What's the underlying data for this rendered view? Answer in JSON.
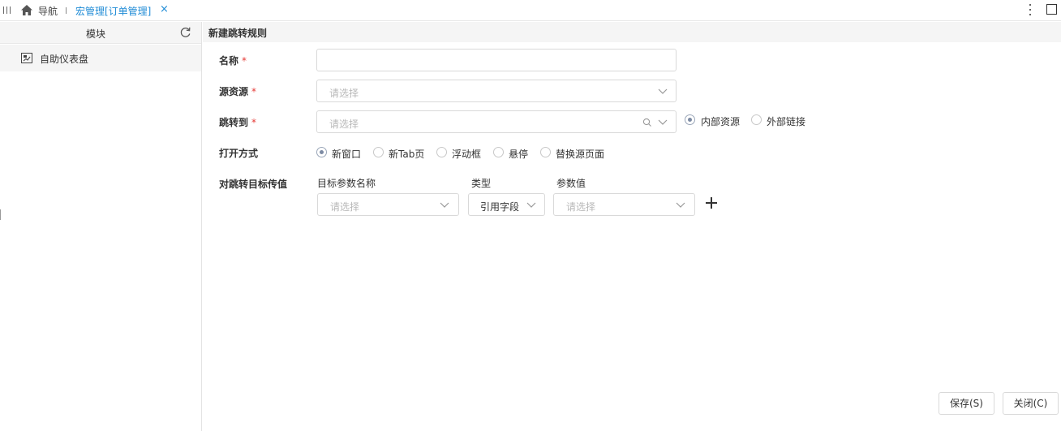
{
  "nav": {
    "label": "导航",
    "active_tab": "宏管理[订单管理]",
    "close_glyph": "×"
  },
  "sidebar": {
    "title": "模块",
    "items": [
      {
        "label": "自助仪表盘"
      }
    ]
  },
  "form": {
    "title": "新建跳转规则",
    "name": {
      "label": "名称",
      "required": "*",
      "value": ""
    },
    "source": {
      "label": "源资源",
      "required": "*",
      "placeholder": "请选择"
    },
    "target": {
      "label": "跳转到",
      "required": "*",
      "placeholder": "请选择",
      "options": [
        {
          "label": "内部资源",
          "checked": true
        },
        {
          "label": "外部链接",
          "checked": false
        }
      ]
    },
    "open_mode": {
      "label": "打开方式",
      "options": [
        {
          "label": "新窗口",
          "checked": true
        },
        {
          "label": "新Tab页",
          "checked": false
        },
        {
          "label": "浮动框",
          "checked": false
        },
        {
          "label": "悬停",
          "checked": false
        },
        {
          "label": "替换源页面",
          "checked": false
        }
      ]
    },
    "params": {
      "label": "对跳转目标传值",
      "columns": [
        "目标参数名称",
        "类型",
        "参数值"
      ],
      "row": {
        "name_placeholder": "请选择",
        "type_value": "引用字段",
        "value_placeholder": "请选择"
      }
    }
  },
  "buttons": {
    "save": "保存(S)",
    "close": "关闭(C)"
  },
  "colors": {
    "accent": "#1e8bd6",
    "required": "#e53935",
    "placeholder": "#b8b8b8"
  }
}
